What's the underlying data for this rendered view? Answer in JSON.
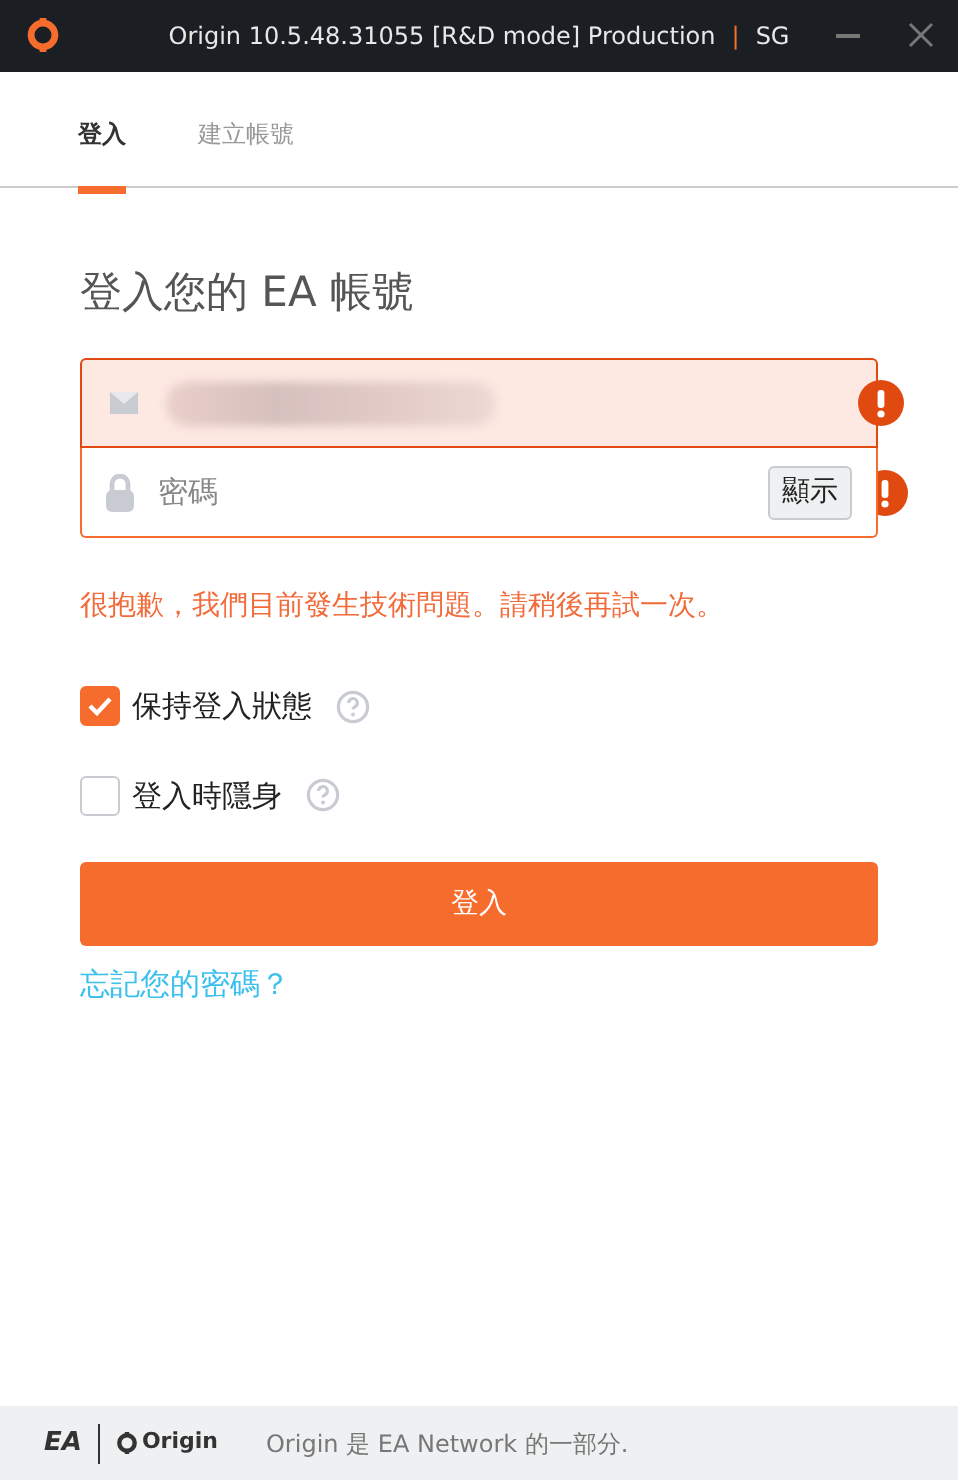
{
  "window": {
    "title": "Origin 10.5.48.31055 [R&D mode] Production",
    "separator": "|",
    "region": "SG"
  },
  "tabs": [
    {
      "label": "登入",
      "selected": true
    },
    {
      "label": "建立帳號",
      "selected": false
    }
  ],
  "heading": "登入您的 EA 帳號",
  "fields": [
    {
      "kind": "email",
      "error": true,
      "blurred": true
    },
    {
      "kind": "password",
      "error": true,
      "placeholder": "密碼",
      "button": "顯示"
    }
  ],
  "error_message": "很抱歉，我們目前發生技術問題。請稍後再試一次。",
  "options": [
    {
      "label": "保持登入狀態",
      "checked": true
    },
    {
      "label": "登入時隱身",
      "checked": false
    }
  ],
  "submit": "登入",
  "forgot_link": "忘記您的密碼？",
  "footer": {
    "ea_logo": "EA",
    "origin_logo": "Origin",
    "text": "Origin 是 EA Network 的一部分."
  }
}
